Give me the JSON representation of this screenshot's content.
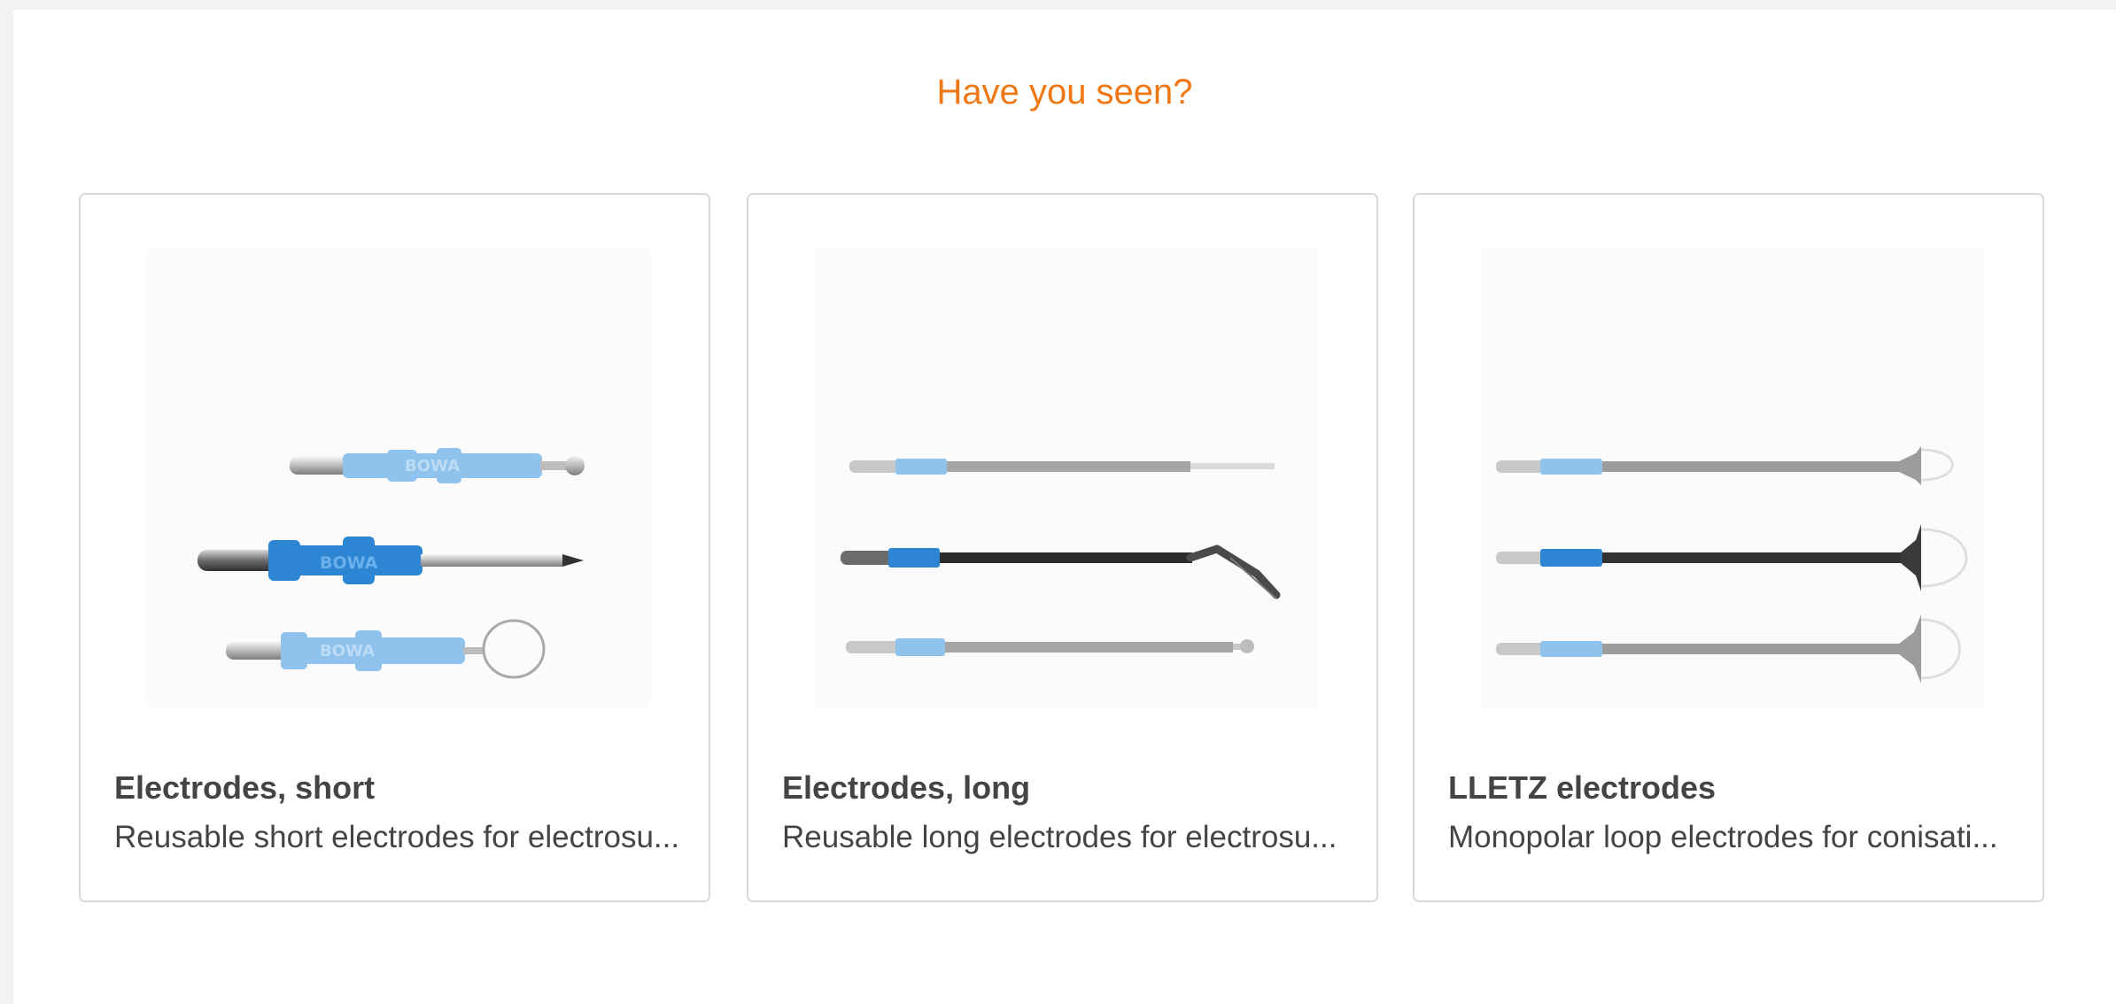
{
  "section": {
    "title": "Have you seen?"
  },
  "cards": [
    {
      "title": "Electrodes, short",
      "description": "Reusable short electrodes for electrosu...",
      "image_icon": "short-electrodes-image",
      "brand_text": "BOWA"
    },
    {
      "title": "Electrodes, long",
      "description": "Reusable long electrodes for electrosu...",
      "image_icon": "long-electrodes-image"
    },
    {
      "title": "LLETZ electrodes",
      "description": "Monopolar loop electrodes for conisati...",
      "image_icon": "lletz-electrodes-image"
    }
  ],
  "colors": {
    "accent": "#f07814",
    "text": "#444444",
    "card_border": "#d6d9de",
    "electrode_blue": "#2d86d3",
    "electrode_light_blue": "#8fc2ec"
  }
}
